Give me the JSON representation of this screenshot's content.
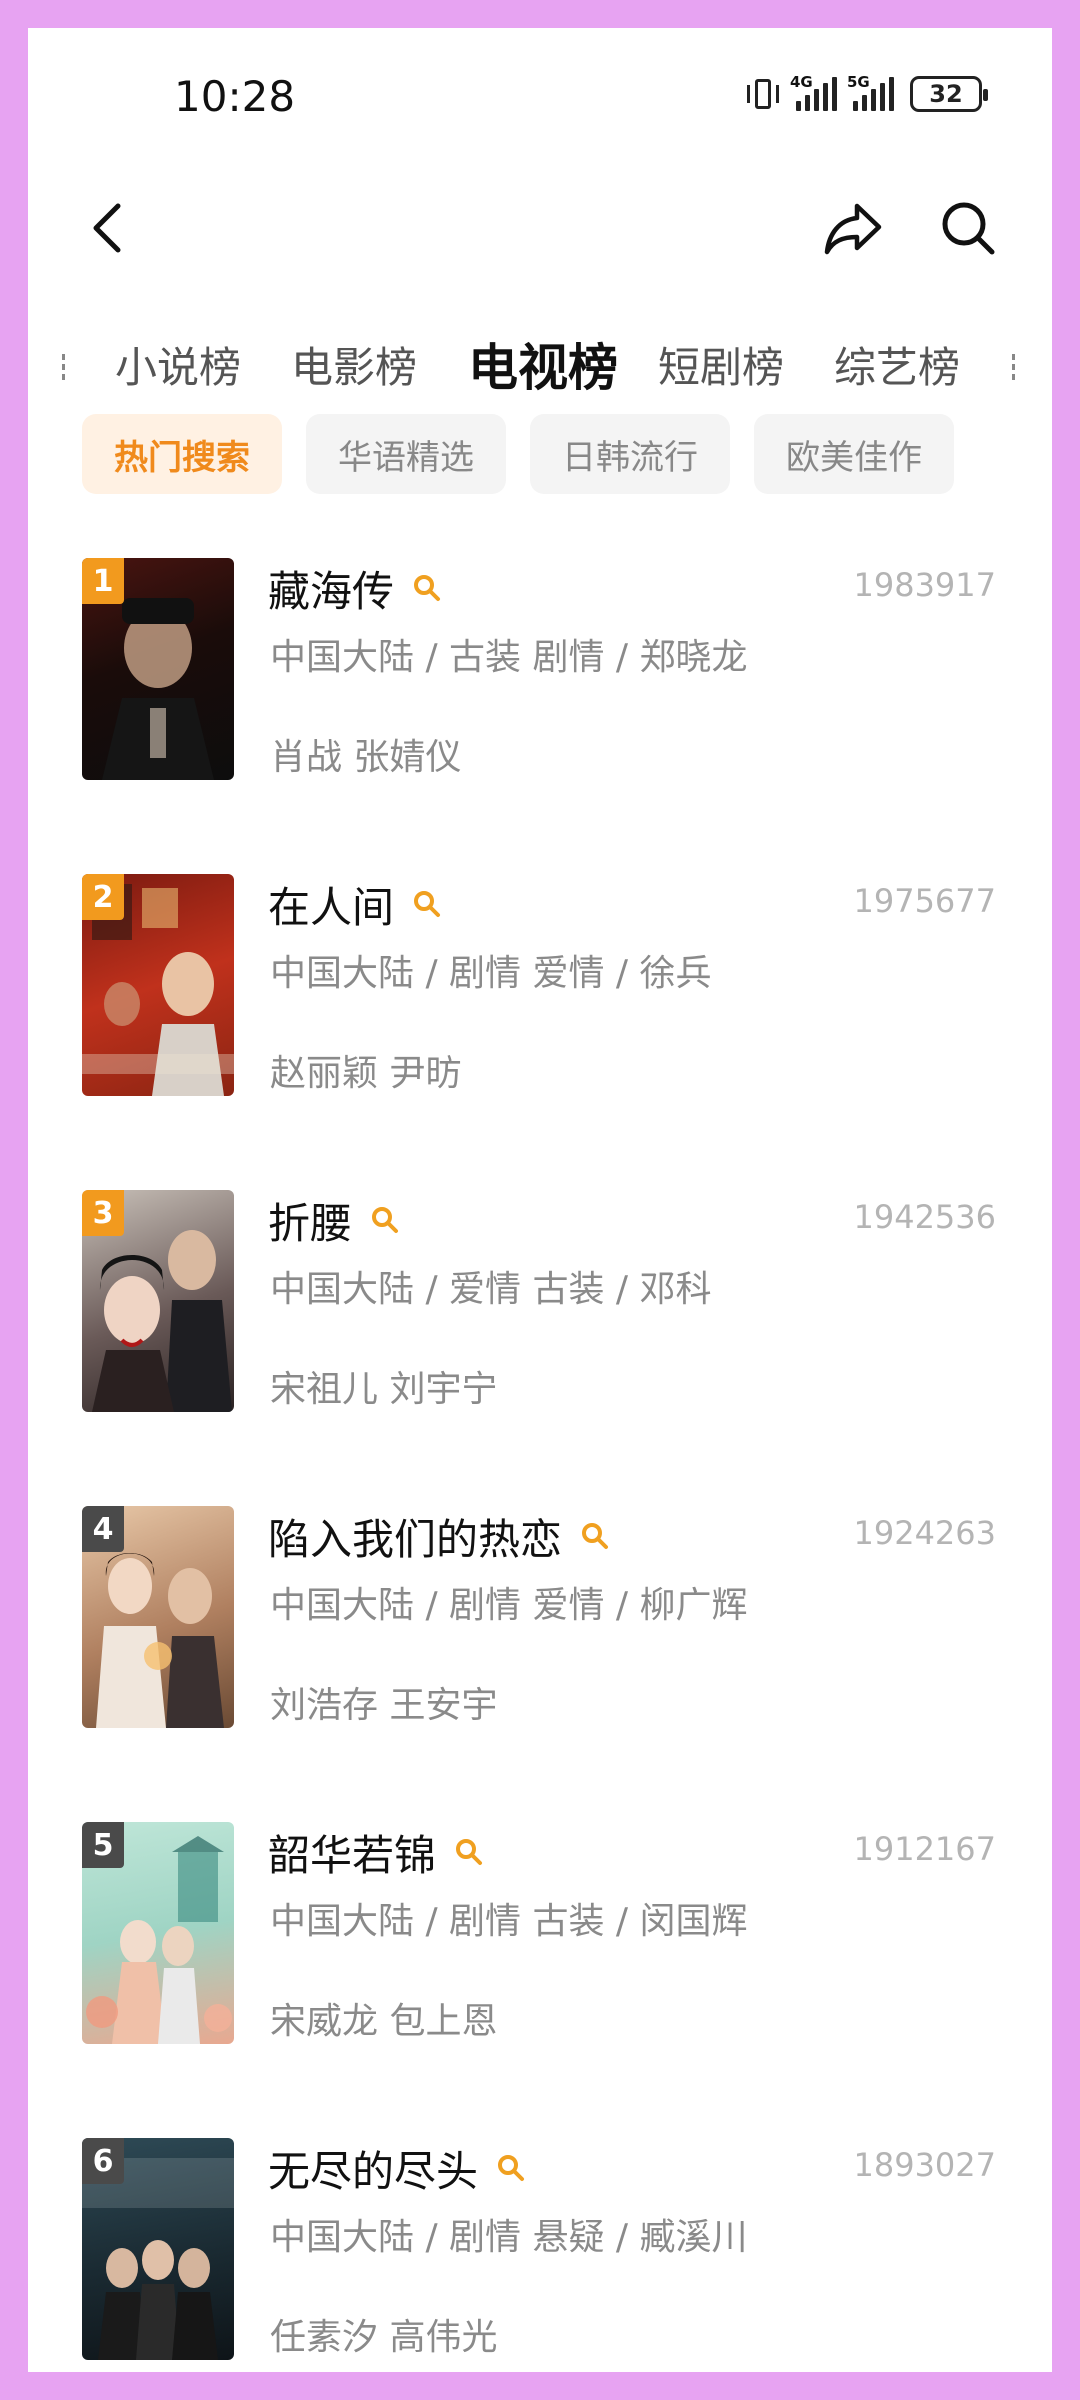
{
  "status_bar": {
    "time": "10:28",
    "network_1": "4G",
    "network_2": "5G",
    "battery": "32",
    "icons": [
      "vibrate-icon",
      "signal-icon",
      "signal-icon",
      "battery-icon"
    ]
  },
  "nav": {
    "icons": [
      "back-arrow-icon",
      "share-icon",
      "search-icon"
    ]
  },
  "category_tabs": {
    "items": [
      {
        "label": "小说榜"
      },
      {
        "label": "电影榜"
      },
      {
        "label": "电视榜"
      },
      {
        "label": "短剧榜"
      },
      {
        "label": "综艺榜"
      }
    ],
    "active": "电视榜"
  },
  "sub_tabs": {
    "items": [
      {
        "label": "热门搜索"
      },
      {
        "label": "华语精选"
      },
      {
        "label": "日韩流行"
      },
      {
        "label": "欧美佳作"
      }
    ],
    "active": "热门搜索"
  },
  "colors": {
    "accent": "#f08a1c",
    "active_chip_bg": "#fff1e3",
    "background_frame": "#e7a3f2",
    "rank_top3": "#f29a1e",
    "rank_other": "#4a4a4a"
  },
  "list": {
    "items": [
      {
        "rank": "1",
        "title": "藏海传",
        "meta": "中国大陆 / 古装 剧情 / 郑晓龙",
        "cast": "肖战 张婧仪",
        "count": "1983917"
      },
      {
        "rank": "2",
        "title": "在人间",
        "meta": "中国大陆 / 剧情 爱情 / 徐兵",
        "cast": "赵丽颖 尹昉",
        "count": "1975677"
      },
      {
        "rank": "3",
        "title": "折腰",
        "meta": "中国大陆 / 爱情 古装 / 邓科",
        "cast": "宋祖儿 刘宇宁",
        "count": "1942536"
      },
      {
        "rank": "4",
        "title": "陷入我们的热恋",
        "meta": "中国大陆 / 剧情 爱情 / 柳广辉",
        "cast": "刘浩存 王安宇",
        "count": "1924263"
      },
      {
        "rank": "5",
        "title": "韶华若锦",
        "meta": "中国大陆 / 剧情 古装 / 闵国辉",
        "cast": "宋威龙 包上恩",
        "count": "1912167"
      },
      {
        "rank": "6",
        "title": "无尽的尽头",
        "meta": "中国大陆 / 剧情 悬疑 / 臧溪川",
        "cast": "任素汐 高伟光",
        "count": "1893027"
      }
    ]
  }
}
